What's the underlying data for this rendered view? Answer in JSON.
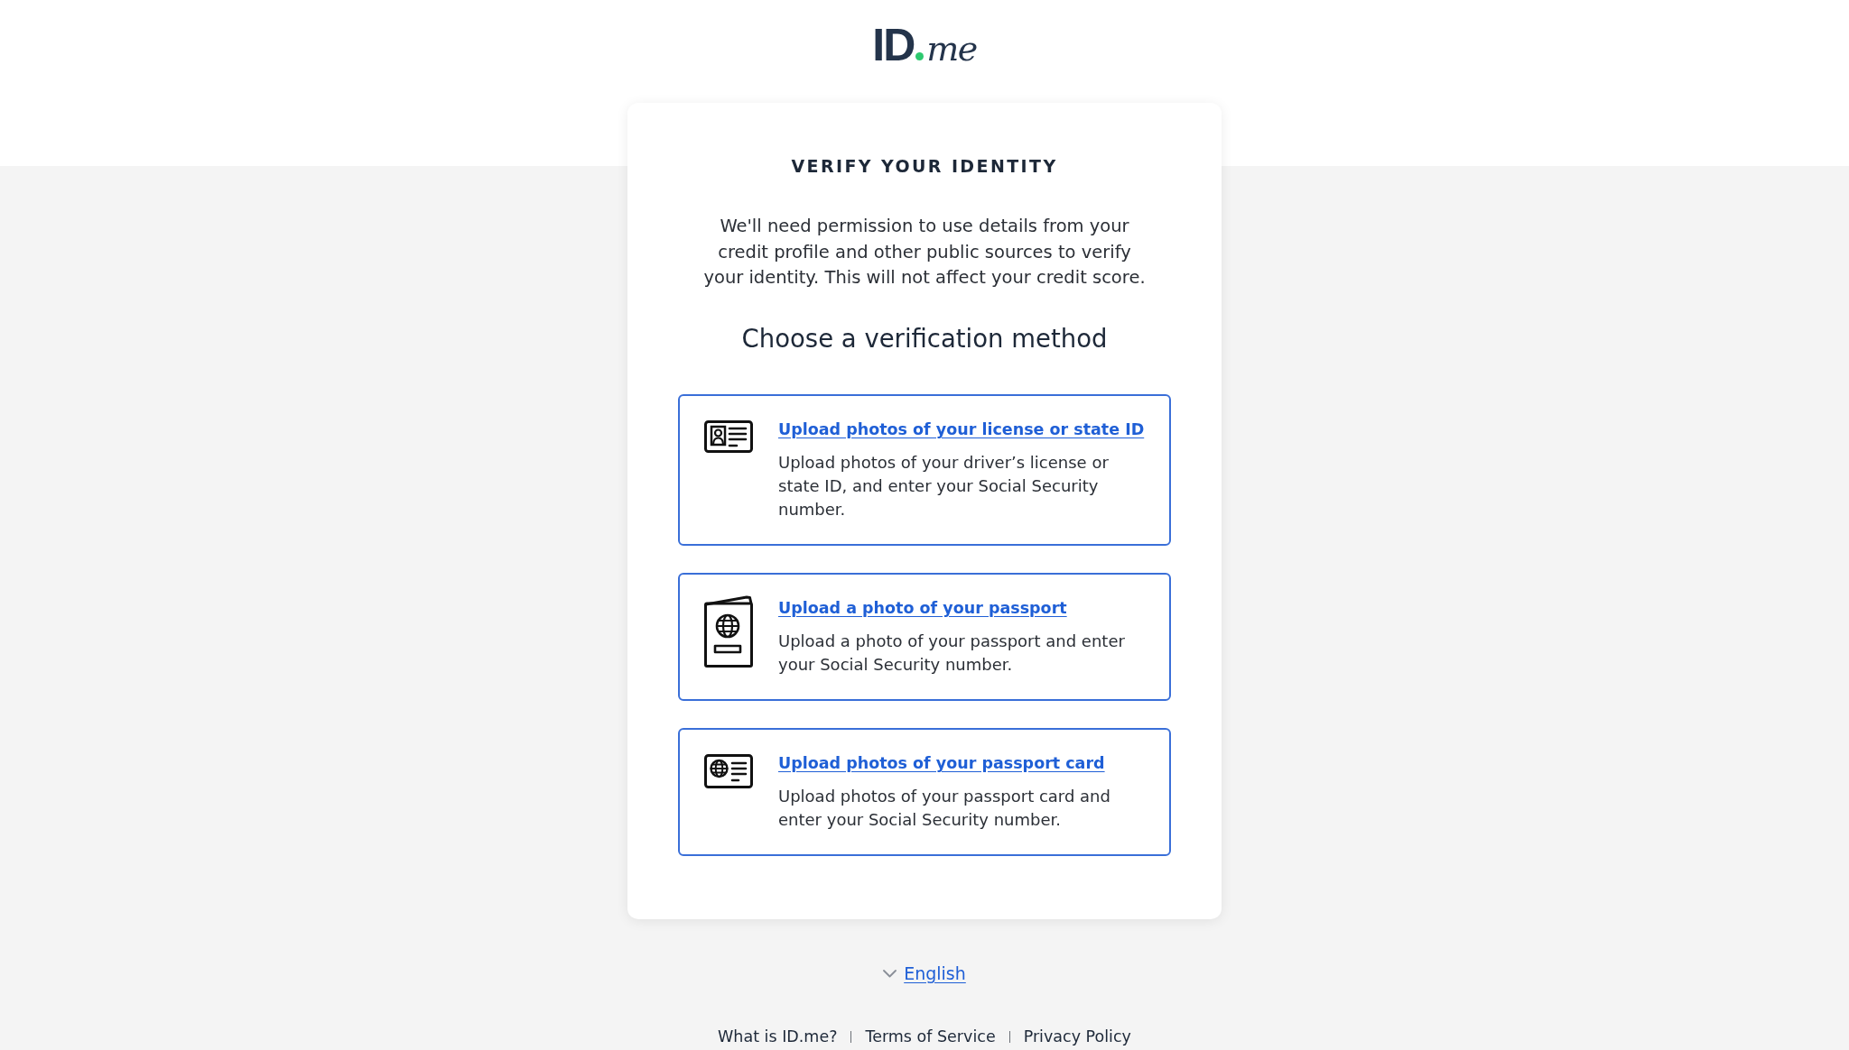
{
  "logo": {
    "text": "ID",
    "suffix": "me"
  },
  "heading": "VERIFY YOUR IDENTITY",
  "intro": "We'll need permission to use details from your credit profile and other public sources to verify your identity. This will not affect your credit score.",
  "subheading": "Choose a verification method",
  "methods": [
    {
      "kind": "id_card",
      "title": "Upload photos of your license or state ID",
      "description": "Upload photos of your driver’s license or state ID, and enter your Social Security number."
    },
    {
      "kind": "passport",
      "title": "Upload a photo of your passport",
      "description": "Upload a photo of your passport and enter your Social Security number."
    },
    {
      "kind": "passport_card",
      "title": "Upload photos of your passport card",
      "description": "Upload photos of your passport card and enter your Social Security number."
    }
  ],
  "language": "English",
  "footer_links": [
    "What is ID.me?",
    "Terms of Service",
    "Privacy Policy"
  ]
}
